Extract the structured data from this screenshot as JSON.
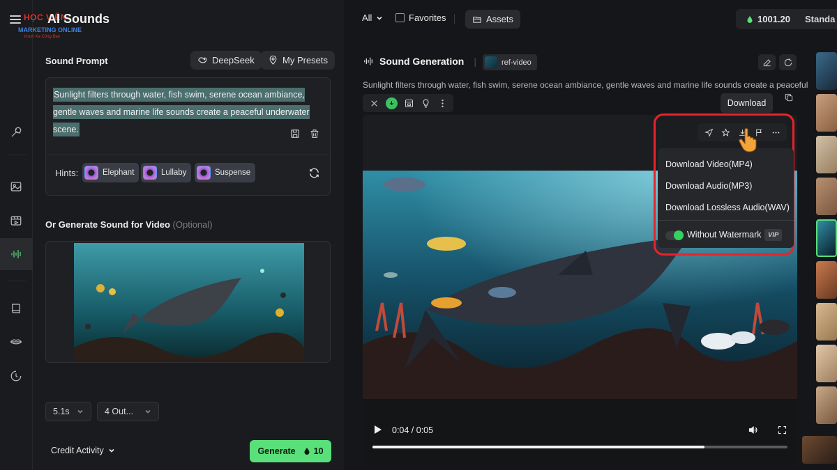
{
  "app": {
    "title": "AI Sounds",
    "logo": {
      "brand": "HỌC VIỆN",
      "sub": "MARKETING ONLINE",
      "tagline": "Vươn Xa Cùng Bạn"
    }
  },
  "left": {
    "sound_prompt_title": "Sound Prompt",
    "deepseek_label": "DeepSeek",
    "presets_label": "My Presets",
    "prompt_text": "Sunlight filters through water, fish swim, serene ocean ambiance, gentle waves and marine life sounds create a peaceful underwater scene.",
    "hints_label": "Hints:",
    "hints": [
      "Elephant",
      "Lullaby",
      "Suspense"
    ],
    "video_section_title": "Or Generate Sound for Video",
    "video_section_optional": "(Optional)",
    "duration_value": "5.1s",
    "outputs_value": "4 Out...",
    "credit_activity_label": "Credit Activity",
    "generate_label": "Generate",
    "generate_cost": "10"
  },
  "topbar": {
    "filter_all": "All",
    "favorites_label": "Favorites",
    "assets_label": "Assets",
    "credits": "1001.20",
    "plan": "Standa"
  },
  "main": {
    "section_title": "Sound Generation",
    "ref_chip_label": "ref-video",
    "description": "Sunlight filters through water, fish swim, serene ocean ambiance, gentle waves and marine life sounds create a peaceful",
    "tooltip": "Download",
    "player": {
      "time": "0:04 / 0:05",
      "progress": 0.8
    },
    "download_menu": {
      "items": [
        "Download Video(MP4)",
        "Download Audio(MP3)",
        "Download Lossless Audio(WAV)"
      ],
      "watermark_label": "Without Watermark",
      "vip_badge": "VIP",
      "watermark_toggle_on": true
    }
  },
  "colors": {
    "accent_green": "#59e07a",
    "highlight_red": "#e8232b",
    "panel_bg": "#1a1b1e"
  }
}
